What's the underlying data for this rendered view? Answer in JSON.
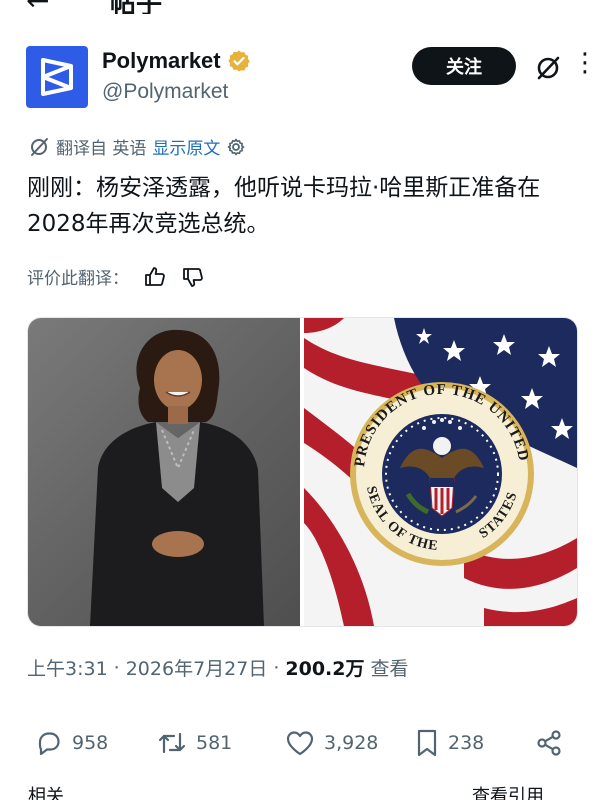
{
  "nav": {
    "back_glyph": "←",
    "title": "帖子"
  },
  "account": {
    "name": "Polymarket",
    "handle": "@Polymarket",
    "verified_color": "#e8b23a",
    "follow_label": "关注",
    "more_glyph": "⋮"
  },
  "translation": {
    "prefix": "翻译自 英语",
    "show_original": "显示原文"
  },
  "post": {
    "text": "刚刚：杨安泽透露，他听说卡玛拉·哈里斯正准备在2028年再次竞选总统。"
  },
  "rating": {
    "label": "评价此翻译："
  },
  "seal": {
    "top_text": "PRESIDENT OF THE UNITED",
    "bottom_text": "SEAL OF THE",
    "right_text": "STATES"
  },
  "meta": {
    "time": "上午3:31",
    "date": "2026年7月27日",
    "views": "200.2万",
    "views_suffix": "查看",
    "sep": "·"
  },
  "actions": {
    "replies": "958",
    "reposts": "581",
    "likes": "3,928",
    "bookmarks": "238"
  },
  "footer": {
    "left": "相关",
    "right": "查看引用"
  },
  "colors": {
    "brand": "#2e5ce6",
    "link": "#1d6fbd",
    "text": "#0f1419",
    "muted": "#536471"
  }
}
